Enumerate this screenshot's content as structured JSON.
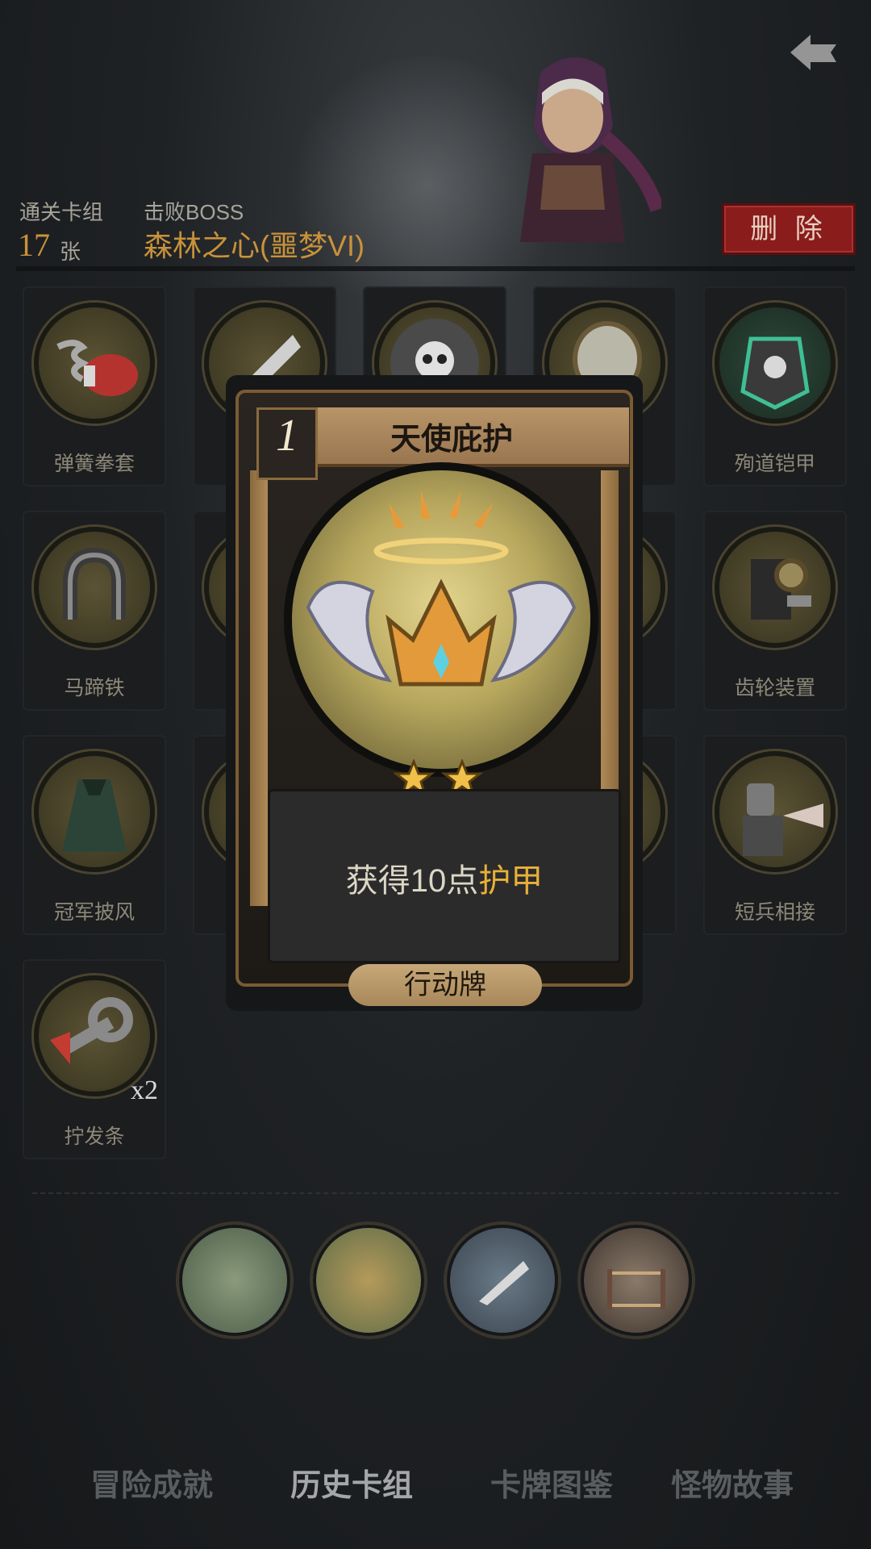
{
  "header": {
    "deck_label": "通关卡组",
    "deck_count": "17",
    "deck_unit": "张",
    "boss_label": "击败BOSS",
    "boss_name": "森林之心(噩梦VI)",
    "delete_label": "删 除"
  },
  "grid_cards": [
    {
      "label": "弹簧拳套",
      "icon": "boxing-glove-spring-icon"
    },
    {
      "label": "",
      "icon": "dagger-icon"
    },
    {
      "label": "",
      "icon": "skull-shield-icon"
    },
    {
      "label": "",
      "icon": "mirror-icon"
    },
    {
      "label": "殉道铠甲",
      "icon": "cursed-armor-icon"
    },
    {
      "label": "马蹄铁",
      "icon": "horseshoe-icon"
    },
    {
      "label": "齿轮装置",
      "icon": "gear-device-icon"
    },
    {
      "label": "冠军披风",
      "icon": "cape-icon"
    },
    {
      "label": "短兵相接",
      "icon": "knight-icon"
    },
    {
      "label": "拧发条",
      "icon": "wind-up-key-icon",
      "count": "x2"
    }
  ],
  "popup_card": {
    "cost": "1",
    "title": "天使庇护",
    "stars": 2,
    "desc_prefix": "获得10点",
    "desc_highlight": "护甲",
    "type": "行动牌",
    "icon": "angel-crown-icon"
  },
  "bosses": [
    {
      "icon": "warlord-icon"
    },
    {
      "icon": "dryad-icon"
    },
    {
      "icon": "knife-icon"
    },
    {
      "icon": "arena-ring-icon"
    }
  ],
  "tabs": [
    {
      "label": "冒险成就",
      "active": false
    },
    {
      "label": "历史卡组",
      "active": true
    },
    {
      "label": "卡牌图鉴",
      "active": false
    },
    {
      "label": "怪物故事",
      "active": false
    }
  ],
  "colors": {
    "accent_gold": "#c9923a",
    "delete_red": "#8a1c1c",
    "highlight": "#e8b03a"
  }
}
